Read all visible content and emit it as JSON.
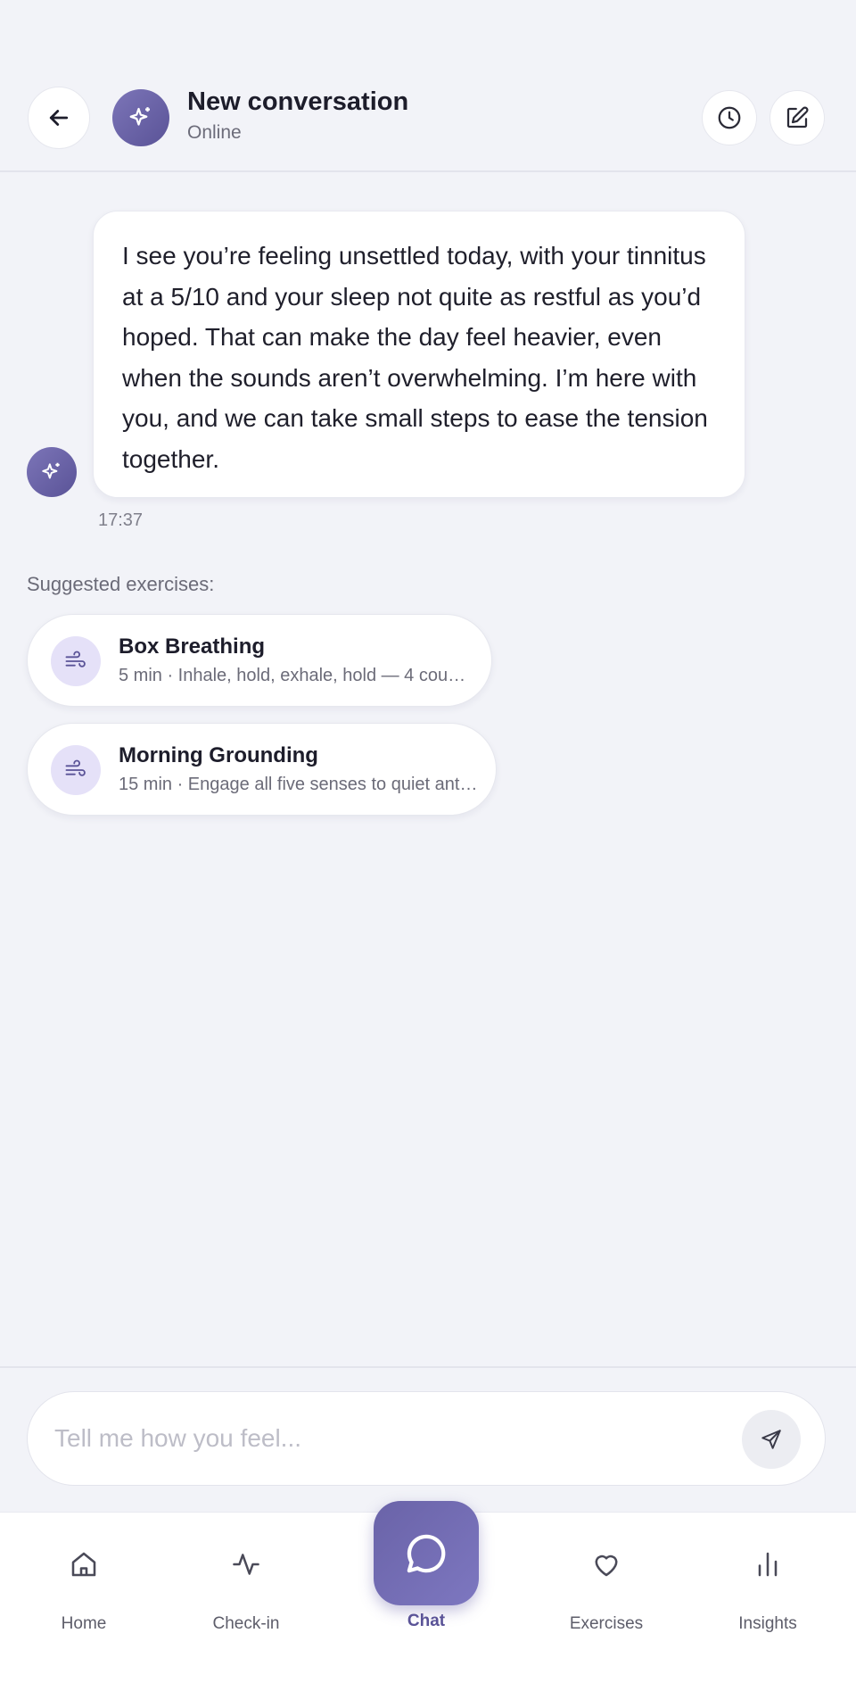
{
  "header": {
    "title": "New conversation",
    "status": "Online"
  },
  "message": {
    "text": "I see you’re feeling unsettled today, with your tinnitus at a 5/10 and your sleep not quite as restful as you’d hoped. That can make the day feel heavier, even when the sounds aren’t overwhelming. I’m here with you, and we can take small steps to ease the tension together.",
    "time": "17:37"
  },
  "suggestions": {
    "label": "Suggested exercises:",
    "items": [
      {
        "title": "Box Breathing",
        "subtitle": "5 min · Inhale, hold, exhale, hold — 4 coun…"
      },
      {
        "title": "Morning Grounding",
        "subtitle": "15 min · Engage all five senses to quiet ant…"
      }
    ]
  },
  "composer": {
    "placeholder": "Tell me how you feel..."
  },
  "nav": {
    "items": [
      {
        "label": "Home"
      },
      {
        "label": "Check-in"
      },
      {
        "label": "Chat"
      },
      {
        "label": "Exercises"
      },
      {
        "label": "Insights"
      }
    ],
    "active": "Chat"
  },
  "colors": {
    "accent": "#5a5397",
    "background": "#f2f3f8",
    "icon_bg": "#e5e1f8"
  }
}
